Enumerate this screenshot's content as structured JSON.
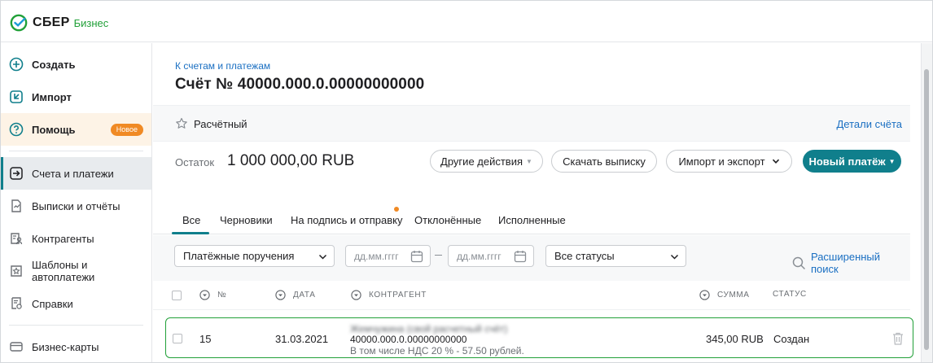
{
  "brand": {
    "name": "СБЕР",
    "sub": "Бизнес",
    "color": "#21a038"
  },
  "sidebar": {
    "items": [
      {
        "label": "Создать",
        "icon": "plus-circle-icon"
      },
      {
        "label": "Импорт",
        "icon": "import-icon"
      },
      {
        "label": "Помощь",
        "icon": "question-circle-icon",
        "badge": "Новое"
      },
      {
        "label": "Счета и платежи",
        "icon": "arrow-in-box-icon",
        "active": true
      },
      {
        "label": "Выписки и отчёты",
        "icon": "statement-icon"
      },
      {
        "label": "Контрагенты",
        "icon": "contractor-icon"
      },
      {
        "label": "Шаблоны и автоплатежи",
        "icon": "template-icon"
      },
      {
        "label": "Справки",
        "icon": "certificate-icon"
      },
      {
        "label": "Бизнес-карты",
        "icon": "card-icon"
      }
    ]
  },
  "main": {
    "breadcrumb": "К счетам и платежам",
    "title": "Счёт № 40000.000.0.00000000000",
    "account_type": "Расчётный",
    "account_details": "Детали счёта",
    "balance_label": "Остаток",
    "balance_value": "1 000 000,00 RUB",
    "actions": {
      "other": "Другие действия",
      "download": "Скачать выписку",
      "import_export": "Импорт и экспорт",
      "new_payment": "Новый платёж"
    },
    "tabs": [
      "Все",
      "Черновики",
      "На подпись и отправку",
      "Отклонённые",
      "Исполненные"
    ],
    "filters": {
      "doc_type": "Платёжные поручения",
      "date_from_placeholder": "дд.мм.гггг",
      "date_to_placeholder": "дд.мм.гггг",
      "status": "Все статусы",
      "advanced_search": "Расширенный поиск"
    },
    "table": {
      "headers": {
        "num": "№",
        "date": "ДАТА",
        "counterparty": "КОНТРАГЕНТ",
        "amount": "СУММА",
        "status": "СТАТУС"
      },
      "rows": [
        {
          "num": "15",
          "date": "31.03.2021",
          "counterparty_name": "Жемчужина (свой расчетный счёт)",
          "counterparty_account": "40000.000.0.00000000000",
          "vat_note": "В том числе НДС 20 % - 57.50 рублей.",
          "amount": "345,00 RUB",
          "status": "Создан"
        }
      ]
    }
  },
  "colors": {
    "accent": "#107f8c",
    "link": "#1a6fc2",
    "badge": "#f08a24",
    "row_border": "#21a038"
  }
}
